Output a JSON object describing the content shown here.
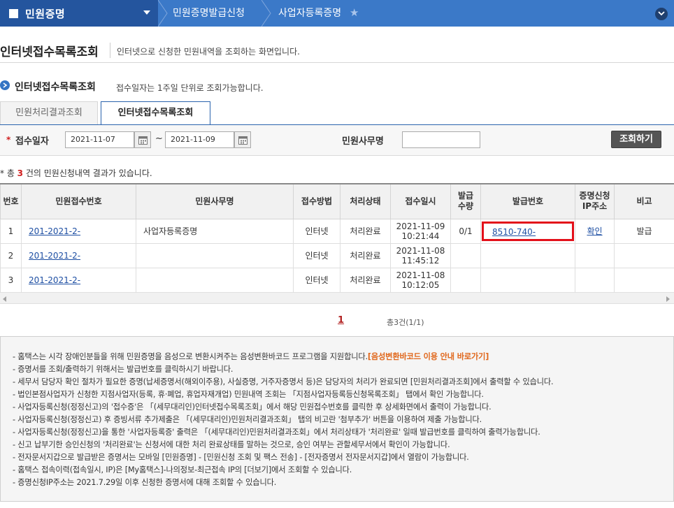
{
  "topnav": {
    "home_label": "민원증명",
    "crumb1": "민원증명발급신청",
    "crumb2": "사업자등록증명"
  },
  "page": {
    "title": "인터넷접수목록조회",
    "desc": "인터넷으로 신청한 민원내역을 조회하는 화면입니다."
  },
  "section": {
    "title": "인터넷접수목록조회",
    "desc": "접수일자는 1주일 단위로 조회가능합니다."
  },
  "tabs": [
    {
      "label": "민원처리결과조회",
      "active": false
    },
    {
      "label": "인터넷접수목록조회",
      "active": true
    }
  ],
  "search": {
    "date_label": "접수일자",
    "date_from": "2021-11-07",
    "tilde": "~",
    "date_to": "2021-11-09",
    "office_label": "민원사무명",
    "office_value": "",
    "button": "조회하기"
  },
  "summary": {
    "prefix": "* 총 ",
    "count": "3",
    "suffix": " 건의 민원신청내역 결과가 있습니다."
  },
  "table": {
    "headers": {
      "no": "번호",
      "receipt_no": "민원접수번호",
      "office": "민원사무명",
      "method": "접수방법",
      "status": "처리상태",
      "datetime": "접수일시",
      "issue_qty": "발급\n수량",
      "issue_no": "발급번호",
      "ip": "증명신청\nIP주소",
      "note": "비고"
    },
    "rows": [
      {
        "no": "1",
        "receipt_no": "201-2021-2-",
        "office": "사업자등록증명",
        "method": "인터넷",
        "status": "처리완료",
        "date": "2021-11-09",
        "time": "10:21:44",
        "issue_qty": "0/1",
        "issue_no": "8510-740-",
        "ip": "확인",
        "note": "발급"
      },
      {
        "no": "2",
        "receipt_no": "201-2021-2-",
        "office": "",
        "method": "인터넷",
        "status": "처리완료",
        "date": "2021-11-08",
        "time": "11:45:12",
        "issue_qty": "",
        "issue_no": "",
        "ip": "",
        "note": ""
      },
      {
        "no": "3",
        "receipt_no": "201-2021-2-",
        "office": "",
        "method": "인터넷",
        "status": "처리완료",
        "date": "2021-11-08",
        "time": "10:12:05",
        "issue_qty": "",
        "issue_no": "",
        "ip": "",
        "note": ""
      }
    ]
  },
  "pagination": {
    "current": "1",
    "total": "총3건(1/1)"
  },
  "notice": {
    "items": [
      "- 홈택스는 시각 장애인분들을 위해 민원증명을 음성으로 변환시켜주는 음성변환바코드 프로그램을 지원합니다.",
      "- 증명서를 조회/출력하기 위해서는 발급번호를 클릭하시기 바랍니다.",
      "- 세무서 담당자 확인 절차가 필요한 증명(납세증명서(해외이주용), 사실증명, 거주자증명서 등)은 담당자의 처리가 완료되면 [민원처리결과조회]에서 출력할 수 있습니다.",
      "- 법인본점사업자가 신청한 지점사업자(등록, 휴·폐업, 휴업자재개업) 민원내역 조회는 「지점사업자등록등신청목록조회」 탭에서 확인 가능합니다.",
      "- 사업자등록신청(정정신고)의 '접수증'은 「(세무대리인)인터넷접수목록조회」에서 해당 민원접수번호를 클릭한 후 상세화면에서 출력이 가능합니다.",
      "- 사업자등록신청(정정신고) 후 증빙서류 추가제출은 「(세무대리인)민원처리결과조회」 탭의 비고란 '첨부추가' 버튼을 이용하여 제출 가능합니다.",
      "- 사업자등록신청(정정신고)을 통한 '사업자등록증' 출력은 「(세무대리인)민원처리결과조회」에서 처리상태가 '처리완료' 일때 발급번호를 클릭하여 출력가능합니다.",
      "- 신고 납부기한 승인신청의 '처리완료'는 신청서에 대한 처리 완료상태를 말하는 것으로, 승인 여부는 관할세무서에서 확인이 가능합니다.",
      "- 전자문서지갑으로 발급받은 증명서는 모바일 [민원증명] - [민원신청 조회 및 팩스 전송] - [전자증명서 전자문서지갑]에서 열람이 가능합니다.",
      "- 홈택스 접속이력(접속일시, IP)은 [My홈택스]-나의정보-최근접속 IP의 [더보기]에서 조회할 수 있습니다.",
      "- 증명신청IP주소는 2021.7.29일 이후 신청한 증명서에 대해 조회할 수 있습니다."
    ],
    "barcode_link": "[음성변환바코드 이용 안내 바로가기]"
  },
  "colors": {
    "nav_bg": "#3b79c8",
    "nav_home_bg": "#24559e",
    "tab_border": "#2a63ad",
    "highlight_box": "#e3101a",
    "link": "#1e4fa3",
    "accent_orange": "#e0661a"
  }
}
